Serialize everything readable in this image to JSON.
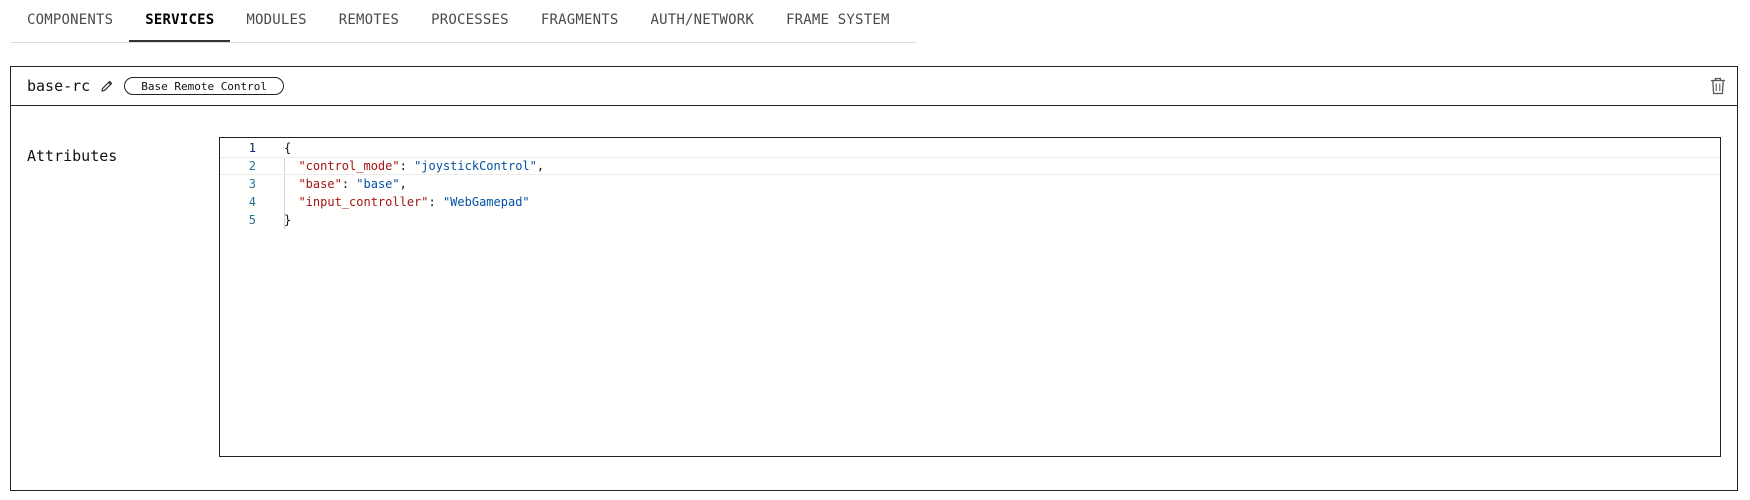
{
  "tabs": [
    {
      "label": "COMPONENTS",
      "active": false
    },
    {
      "label": "SERVICES",
      "active": true
    },
    {
      "label": "MODULES",
      "active": false
    },
    {
      "label": "REMOTES",
      "active": false
    },
    {
      "label": "PROCESSES",
      "active": false
    },
    {
      "label": "FRAGMENTS",
      "active": false
    },
    {
      "label": "AUTH/NETWORK",
      "active": false
    },
    {
      "label": "FRAME SYSTEM",
      "active": false
    }
  ],
  "service": {
    "name": "base-rc",
    "type_badge": "Base Remote Control",
    "attributes_label": "Attributes"
  },
  "editor": {
    "line_numbers": [
      "1",
      "2",
      "3",
      "4",
      "5"
    ],
    "open_brace": "{",
    "close_brace": "}",
    "entries": [
      {
        "key": "\"control_mode\"",
        "value": "\"joystickControl\"",
        "trailing": ","
      },
      {
        "key": "\"base\"",
        "value": "\"base\"",
        "trailing": ","
      },
      {
        "key": "\"input_controller\"",
        "value": "\"WebGamepad\"",
        "trailing": ""
      }
    ]
  },
  "colors": {
    "json_key": "#a31515",
    "json_string": "#0451a5",
    "line_number": "#237893"
  }
}
